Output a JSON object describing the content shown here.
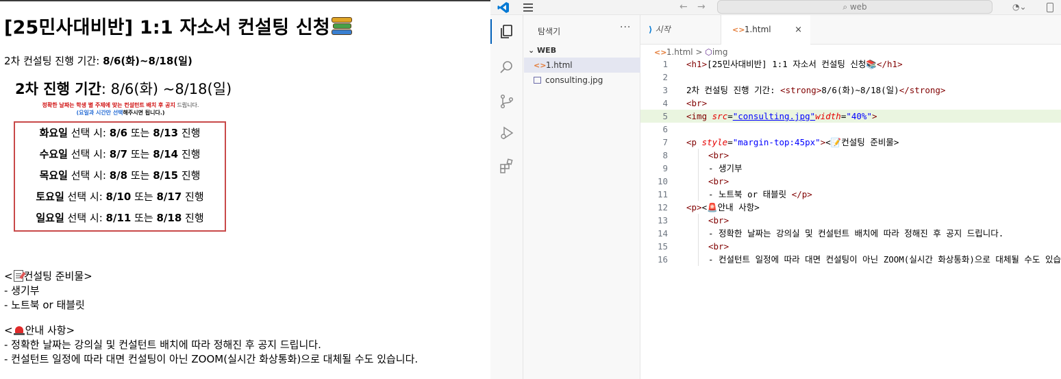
{
  "preview": {
    "h1": "[25민사대비반] 1:1 자소서 컨설팅 신청",
    "schedule_prefix": "2차 컨설팅 진행 기간: ",
    "schedule_period": "8/6(화)~8/18(일)",
    "image": {
      "heading_bold": "2차 진행 기간",
      "heading_rest": ": 8/6(화) ~8/18(일)",
      "note_red": "정확한 날짜는 학생 별 주제에 맞는 컨설턴트 배치 후 공지",
      "note_red_tail": " 드립니다.",
      "note2_blue": "(요일과 시간만 선택",
      "note2_black": "해주시면 됩니다.)",
      "rows": [
        {
          "day": "화요일",
          "mid": " 선택 시: ",
          "d1": "8/6",
          "or": " 또는 ",
          "d2": "8/13",
          "tail": " 진행"
        },
        {
          "day": "수요일",
          "mid": " 선택 시: ",
          "d1": "8/7",
          "or": " 또는 ",
          "d2": "8/14",
          "tail": " 진행"
        },
        {
          "day": "목요일",
          "mid": " 선택 시: ",
          "d1": "8/8",
          "or": " 또는 ",
          "d2": "8/15",
          "tail": " 진행"
        },
        {
          "day": "토요일",
          "mid": " 선택 시: ",
          "d1": "8/10",
          "or": " 또는 ",
          "d2": "8/17",
          "tail": " 진행"
        },
        {
          "day": "일요일",
          "mid": " 선택 시: ",
          "d1": "8/11",
          "or": " 또는 ",
          "d2": "8/18",
          "tail": " 진행"
        }
      ]
    },
    "prep_title": "컨설팅 준비물",
    "prep_items": [
      "- 생기부",
      "- 노트북 or 태블릿"
    ],
    "notice_title": "안내 사항",
    "notice_items": [
      "- 정확한 날짜는 강의실 및 컨설턴트 배치에 따라 정해진 후 공지 드립니다.",
      "- 컨설턴트 일정에 따라 대면 컨설팅이 아닌 ZOOM(실시간 화상통화)으로 대체될 수도 있습니다."
    ]
  },
  "vscode": {
    "search_placeholder": "web",
    "back_icon": "arrow-left-icon",
    "forward_icon": "arrow-right-icon",
    "copilot_label": "⌄",
    "sidebar_title": "탐색기",
    "sidebar_more": "···",
    "folder": "WEB",
    "files": [
      "1.html",
      "consulting.jpg"
    ],
    "tabs": [
      {
        "label": "시작"
      },
      {
        "label": "1.html",
        "close": "×"
      }
    ],
    "breadcrumb": [
      "1.html",
      "img"
    ],
    "breadcrumb_sep": ">",
    "code_lines": [
      {
        "n": "1",
        "parts": [
          [
            "tg",
            "<h1>"
          ],
          [
            "tx",
            "[25민사대비반] 1:1 자소서 컨설팅 신청📚"
          ],
          [
            "tg",
            "</h1>"
          ]
        ]
      },
      {
        "n": "2",
        "parts": []
      },
      {
        "n": "3",
        "parts": [
          [
            "tx",
            "2차 컨설팅 진행 기간: "
          ],
          [
            "tg",
            "<strong>"
          ],
          [
            "tx",
            "8/6(화)~8/18(일)"
          ],
          [
            "tg",
            "</strong>"
          ]
        ]
      },
      {
        "n": "4",
        "parts": [
          [
            "tg",
            "<br>"
          ]
        ]
      },
      {
        "n": "5",
        "parts": [
          [
            "tg",
            "<img "
          ],
          [
            "at",
            "src"
          ],
          [
            "tx",
            "="
          ],
          [
            "avu",
            "\"consulting.jpg\""
          ],
          [
            "at",
            "width"
          ],
          [
            "tx",
            "="
          ],
          [
            "av",
            "\"40%\""
          ],
          [
            "tg",
            ">"
          ]
        ]
      },
      {
        "n": "6",
        "parts": []
      },
      {
        "n": "7",
        "parts": [
          [
            "tg",
            "<p "
          ],
          [
            "at",
            "style"
          ],
          [
            "tx",
            "="
          ],
          [
            "av",
            "\"margin-top:45px\""
          ],
          [
            "tg",
            ">"
          ],
          [
            "tx",
            "<📝컨설팅 준비물>"
          ]
        ]
      },
      {
        "n": "8",
        "parts": [
          [
            "tg",
            "<br>"
          ]
        ],
        "indent": true
      },
      {
        "n": "9",
        "parts": [
          [
            "tx",
            "- 생기부"
          ]
        ],
        "indent": true
      },
      {
        "n": "10",
        "parts": [
          [
            "tg",
            "<br>"
          ]
        ],
        "indent": true
      },
      {
        "n": "11",
        "parts": [
          [
            "tx",
            "- 노트북 or 태블릿 "
          ],
          [
            "tg",
            "</p>"
          ]
        ],
        "indent": true
      },
      {
        "n": "12",
        "parts": [
          [
            "tg",
            "<p>"
          ],
          [
            "tx",
            "<🚨안내 사항>"
          ]
        ]
      },
      {
        "n": "13",
        "parts": [
          [
            "tg",
            "<br>"
          ]
        ],
        "indent": true
      },
      {
        "n": "14",
        "parts": [
          [
            "tx",
            "- 정확한 날짜는 강의실 및 컨설턴트 배치에 따라 정해진 후 공지 드립니다."
          ]
        ],
        "indent": true
      },
      {
        "n": "15",
        "parts": [
          [
            "tg",
            "<br>"
          ]
        ],
        "indent": true
      },
      {
        "n": "16",
        "parts": [
          [
            "tx",
            "- 컨설턴트 일정에 따라 대면 컨설팅이 아닌 ZOOM(실시간 화상통화)으로 대체될 수도 있습니다."
          ]
        ],
        "indent": true
      }
    ],
    "highlighted_line": "5",
    "colors": {
      "accent": "#005fb8",
      "tag": "#800000",
      "attr": "#e50000",
      "value": "#0000ff",
      "border_red": "#c84848"
    }
  }
}
